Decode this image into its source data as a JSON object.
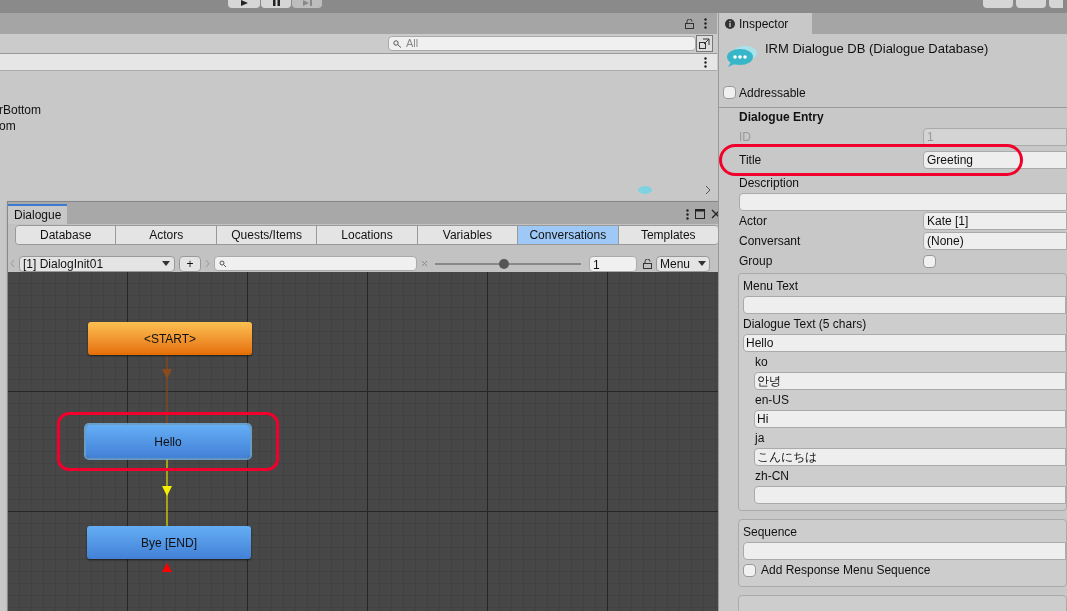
{
  "project_panel": {
    "search": {
      "placeholder": "All"
    },
    "items": [
      "rBottom",
      "om"
    ]
  },
  "dialogue_window": {
    "title": "Dialogue",
    "tabs": [
      {
        "label": "Database",
        "selected": false
      },
      {
        "label": "Actors",
        "selected": false
      },
      {
        "label": "Quests/Items",
        "selected": false
      },
      {
        "label": "Locations",
        "selected": false
      },
      {
        "label": "Variables",
        "selected": false
      },
      {
        "label": "Conversations",
        "selected": true
      },
      {
        "label": "Templates",
        "selected": false
      }
    ],
    "conversation": "[1] DialogInit01",
    "add_button": "+",
    "zoom": {
      "level": 0.47
    },
    "zoom_value": "1",
    "menu": "Menu",
    "nodes": [
      {
        "label": "<START>",
        "kind": "start",
        "highlighted": false
      },
      {
        "label": "Hello",
        "kind": "entry",
        "highlighted": true
      },
      {
        "label": "Bye [END]",
        "kind": "entry",
        "highlighted": false
      }
    ]
  },
  "inspector": {
    "tab": "Inspector",
    "object_title": "IRM Dialogue DB (Dialogue Database)",
    "addressable": {
      "label": "Addressable",
      "checked": false
    },
    "section_title": "Dialogue Entry",
    "fields": [
      {
        "kind": "inline",
        "label": "ID",
        "value": "1",
        "disabled": true,
        "highlighted": false
      },
      {
        "kind": "inline",
        "label": "Title",
        "value": "Greeting",
        "disabled": false,
        "highlighted": true
      },
      {
        "kind": "stacked",
        "label": "Description"
      },
      {
        "kind": "inline",
        "label": "Actor",
        "value": "Kate [1]",
        "disabled": false,
        "highlighted": false
      },
      {
        "kind": "inline",
        "label": "Conversant",
        "value": "(None)",
        "disabled": false,
        "highlighted": false
      },
      {
        "kind": "checkbox",
        "label": "Group",
        "checked": false
      }
    ],
    "boxes": [
      {
        "fields": [
          {
            "kind": "stacked",
            "label": "Menu Text"
          },
          {
            "kind": "stacked",
            "label": "Dialogue Text (5 chars)",
            "value": "Hello"
          },
          {
            "kind": "sub",
            "label": "ko",
            "value": "안녕"
          },
          {
            "kind": "sub",
            "label": "en-US",
            "value": "Hi"
          },
          {
            "kind": "sub",
            "label": "ja",
            "value": "こんにちは"
          },
          {
            "kind": "sub",
            "label": "zh-CN"
          }
        ]
      },
      {
        "fields": [
          {
            "kind": "stacked",
            "label": "Sequence"
          },
          {
            "kind": "checkbox2",
            "label": "Add Response Menu Sequence",
            "checked": false
          }
        ]
      }
    ]
  }
}
